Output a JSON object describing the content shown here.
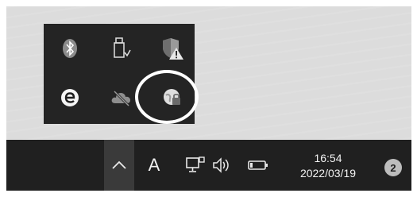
{
  "tray_flyout": {
    "icons": [
      {
        "name": "bluetooth-icon"
      },
      {
        "name": "usb-eject-icon"
      },
      {
        "name": "security-warning-icon"
      },
      {
        "name": "edge-e-icon"
      },
      {
        "name": "onedrive-offline-icon"
      },
      {
        "name": "vpn-lock-icon",
        "highlighted": true
      }
    ]
  },
  "taskbar": {
    "ime_label": "A",
    "clock_time": "16:54",
    "clock_date": "2022/03/19",
    "notification_count": "2"
  },
  "colors": {
    "taskbar": "#202020",
    "flyout": "#242424",
    "highlight_ring": "#ffffff"
  }
}
